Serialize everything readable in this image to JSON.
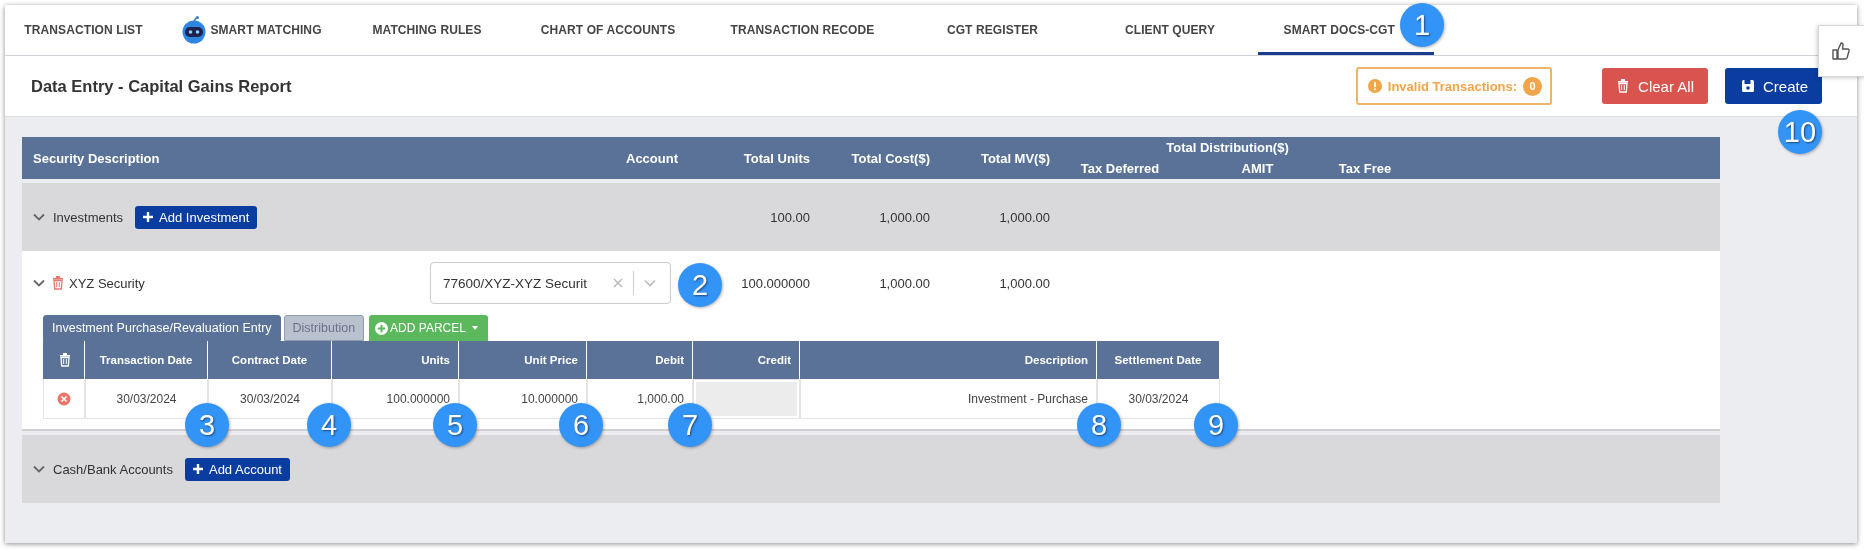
{
  "tabs": [
    {
      "label": "TRANSACTION LIST",
      "kind": "plain",
      "selected": false
    },
    {
      "label": "SMART MATCHING",
      "kind": "robot",
      "selected": false
    },
    {
      "label": "MATCHING RULES",
      "kind": "plain",
      "selected": false
    },
    {
      "label": "CHART OF ACCOUNTS",
      "kind": "plain",
      "selected": false
    },
    {
      "label": "TRANSACTION RECODE",
      "kind": "plain",
      "selected": false
    },
    {
      "label": "CGT REGISTER",
      "kind": "plain",
      "selected": false
    },
    {
      "label": "CLIENT QUERY",
      "kind": "plain",
      "selected": false
    },
    {
      "label": "SMART DOCS-CGT",
      "kind": "plain",
      "selected": true
    }
  ],
  "page_title": "Data Entry - Capital Gains Report",
  "toolbar": {
    "invalid_label": "Invalid Transactions:",
    "invalid_count": "0",
    "clear_label": "Clear All",
    "create_label": "Create"
  },
  "table": {
    "columns": [
      "Security Description",
      "Account",
      "Total Units",
      "Total Cost($)",
      "Total MV($)"
    ],
    "distribution_header": "Total Distribution($)",
    "distribution_columns": [
      "Tax Deferred",
      "AMIT",
      "Tax Free"
    ]
  },
  "sections": [
    {
      "name": "Investments",
      "button": "Add Investment",
      "total_units": "100.00",
      "total_cost": "1,000.00",
      "total_mv": "1,000.00",
      "items": [
        {
          "name": "XYZ Security",
          "account": "77600/XYZ-XYZ Securit",
          "total_units": "100.000000",
          "total_cost": "1,000.00",
          "total_mv": "1,000.00",
          "entry_tabs": [
            {
              "label": "Investment Purchase/Revaluation Entry",
              "selected": true
            },
            {
              "label": "Distribution",
              "selected": false
            }
          ],
          "add_parcel": "ADD PARCEL",
          "entry_columns": [
            "Transaction Date",
            "Contract Date",
            "Units",
            "Unit Price",
            "Debit",
            "Credit",
            "Description",
            "Settlement Date"
          ],
          "entries": [
            {
              "cells": [
                {
                  "value": "30/03/2024",
                  "disabled": false
                },
                {
                  "value": "30/03/2024",
                  "disabled": false
                },
                {
                  "value": "100.000000",
                  "disabled": false
                },
                {
                  "value": "10.000000",
                  "disabled": false
                },
                {
                  "value": "1,000.00",
                  "disabled": false
                },
                {
                  "disabled": true
                },
                {
                  "value": "Investment - Purchase",
                  "disabled": false
                },
                {
                  "value": "30/03/2024",
                  "disabled": false
                }
              ]
            }
          ]
        }
      ]
    },
    {
      "name": "Cash/Bank Accounts",
      "button": "Add Account"
    }
  ],
  "callouts": [
    "1",
    "2",
    "3",
    "4",
    "5",
    "6",
    "7",
    "8",
    "9",
    "10"
  ]
}
